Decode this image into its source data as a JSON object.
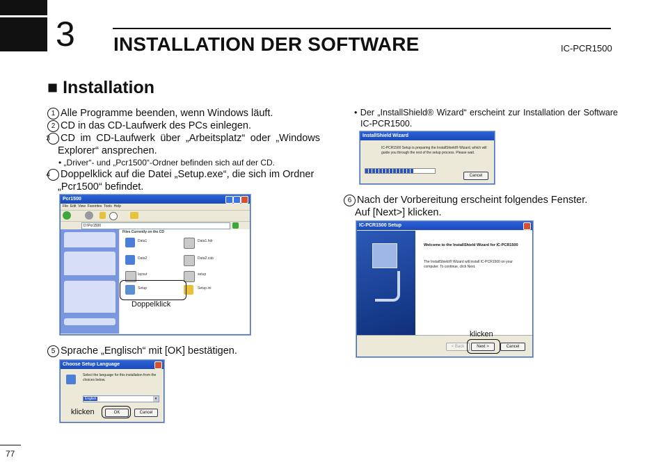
{
  "header": {
    "chapter_number": "3",
    "title": "INSTALLATION DER SOFTWARE",
    "model": "IC-PCR1500"
  },
  "section": {
    "marker": "■",
    "title": "Installation"
  },
  "steps": {
    "s1": {
      "num": "1",
      "text": "Alle Programme beenden, wenn Windows läuft."
    },
    "s2": {
      "num": "2",
      "text": "CD in das CD-Laufwerk des PCs einlegen."
    },
    "s3": {
      "num": "3",
      "text": "CD im CD-Laufwerk über „Arbeitsplatz“ oder „Windows Explorer“ ansprechen."
    },
    "s3_note": "• „Driver“- und „Pcr1500“-Ordner befinden sich auf der CD.",
    "s4": {
      "num": "4",
      "text": "Doppelklick auf die Datei „Setup.exe“, die sich im Ordner „Pcr1500“ befindet."
    },
    "s5": {
      "num": "5",
      "text": "Sprache „Englisch“ mit [OK] bestätigen."
    },
    "installshield_note": "• Der „InstallShield® Wizard“ erscheint zur Installation der Software IC-PCR1500.",
    "s6": {
      "num": "6",
      "line1": "Nach der Vorbereitung erscheint folgendes Fenster.",
      "line2": "Auf [Next>] klicken."
    }
  },
  "screenshots": {
    "explorer": {
      "title": "Pcr1500",
      "menu": [
        "File",
        "Edit",
        "View",
        "Favorites",
        "Tools",
        "Help"
      ],
      "address": "D:\\Pcr1500",
      "content_header": "Files Currently on the CD",
      "files": [
        "Data1",
        "Data1.hdr",
        "Data2",
        "Data2.cab",
        "layout",
        "setup",
        "Setup",
        "Setup.ini"
      ],
      "callout_label": "Doppelklick"
    },
    "language": {
      "title": "Choose Setup Language",
      "message": "Select the language for this installation from the choices below.",
      "selected": "English",
      "ok": "OK",
      "cancel": "Cancel",
      "callout_label": "klicken"
    },
    "preparing": {
      "title": "InstallShield Wizard",
      "message": "IC-PCR1500 Setup is preparing the InstallShield® Wizard, which will guide you through the rest of the setup process. Please wait.",
      "cancel": "Cancel"
    },
    "welcome": {
      "title": "IC-PCR1500 Setup",
      "heading": "Welcome to the InstallShield Wizard for IC-PCR1500",
      "body": "The InstallShield® Wizard will install IC-PCR1500 on your computer. To continue, click Next.",
      "back": "< Back",
      "next": "Next >",
      "cancel": "Cancel",
      "callout_label": "klicken"
    }
  },
  "footer": {
    "page_number": "77"
  },
  "colors": {
    "xp_title": "#1b49b8",
    "xp_face": "#ece9d8",
    "progress": "#2a52c8"
  }
}
